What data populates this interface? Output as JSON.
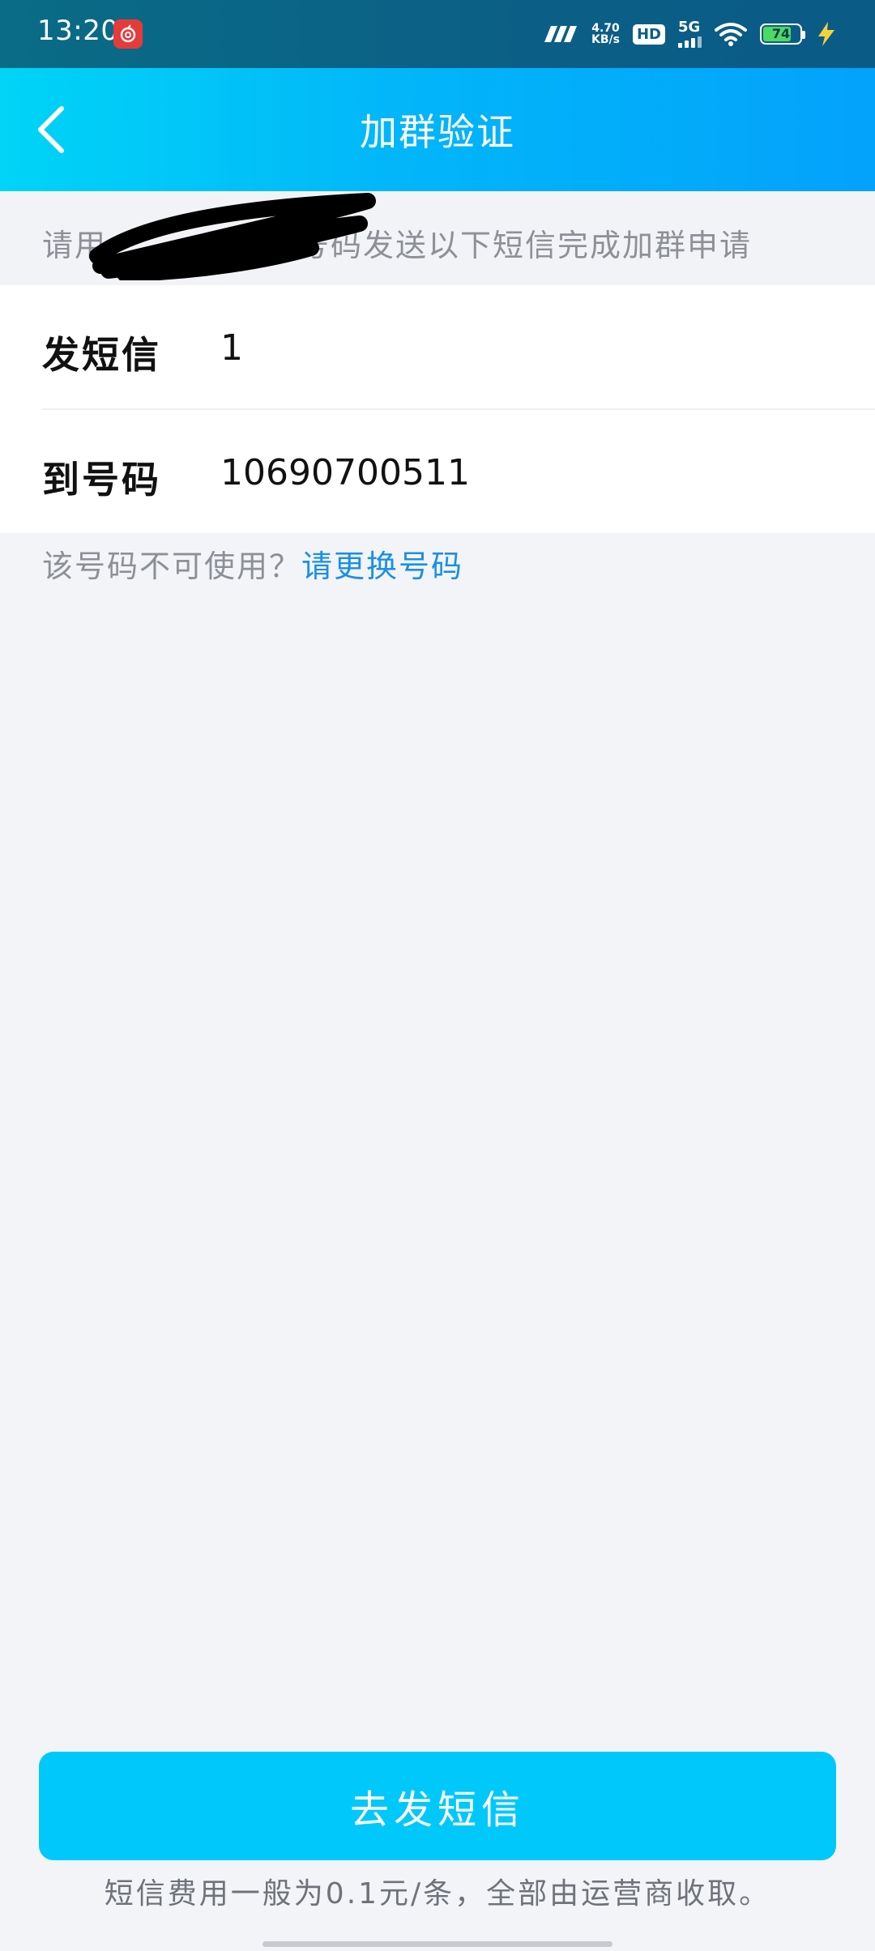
{
  "status_bar": {
    "time": "13:20",
    "speed_value": "4.70",
    "speed_unit": "KB/s",
    "hd": "HD",
    "network": "5G",
    "battery": "74"
  },
  "header": {
    "title": "加群验证"
  },
  "instruction": {
    "prefix": "请用",
    "suffix": "号码发送以下短信完成加群申请"
  },
  "message_info": {
    "send_label": "发短信",
    "send_value": "1",
    "to_label": "到号码",
    "to_value": "10690700511"
  },
  "change_number": {
    "question": "该号码不可使用？",
    "link": "请更换号码"
  },
  "action": {
    "button_label": "去发短信"
  },
  "footer": {
    "note": "短信费用一般为0.1元/条，全部由运营商收取。"
  },
  "colors": {
    "header_gradient_start": "#00d4f7",
    "header_gradient_end": "#03a2fb",
    "button": "#00c8fb",
    "link": "#1a8fe6"
  }
}
